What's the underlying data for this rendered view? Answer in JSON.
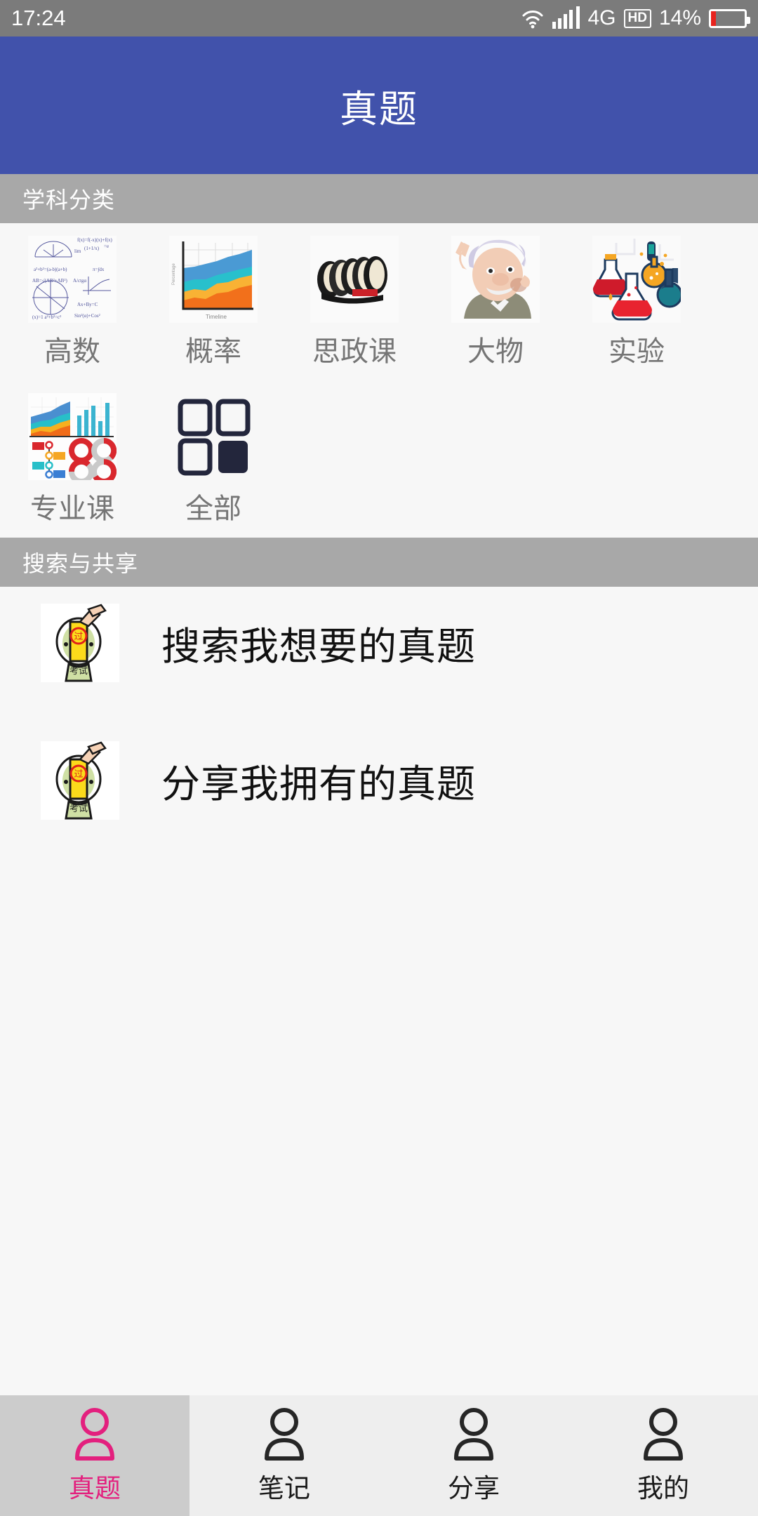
{
  "statusbar": {
    "time": "17:24",
    "network": "4G",
    "hd_badge": "HD",
    "battery_percent": "14%",
    "battery_level": 14,
    "icons": [
      "wifi-icon",
      "signal-bars-icon",
      "hd-icon",
      "battery-icon"
    ]
  },
  "appbar": {
    "title": "真题",
    "background_color": "#4152ab",
    "title_color": "#ffffff"
  },
  "sections": {
    "categories": {
      "header": "学科分类",
      "header_bg": "#a8a8a8",
      "items": [
        {
          "label": "高数",
          "icon": "math-formulas-icon"
        },
        {
          "label": "概率",
          "icon": "area-chart-icon"
        },
        {
          "label": "思政课",
          "icon": "political-portraits-icon"
        },
        {
          "label": "大物",
          "icon": "einstein-icon"
        },
        {
          "label": "实验",
          "icon": "chemistry-flasks-icon"
        },
        {
          "label": "专业课",
          "icon": "infographic-dashboard-icon"
        },
        {
          "label": "全部",
          "icon": "grid-squares-icon"
        }
      ]
    },
    "search_share": {
      "header": "搜索与共享",
      "header_bg": "#a8a8a8",
      "rows": [
        {
          "label": "搜索我想要的真题",
          "icon": "exam-charm-mascot-icon"
        },
        {
          "label": "分享我拥有的真题",
          "icon": "exam-charm-mascot-icon"
        }
      ]
    }
  },
  "tabbar": {
    "active_color": "#e3207e",
    "active_index": 0,
    "tabs": [
      {
        "label": "真题",
        "icon": "person-icon"
      },
      {
        "label": "笔记",
        "icon": "person-icon"
      },
      {
        "label": "分享",
        "icon": "person-icon"
      },
      {
        "label": "我的",
        "icon": "person-icon"
      }
    ]
  }
}
